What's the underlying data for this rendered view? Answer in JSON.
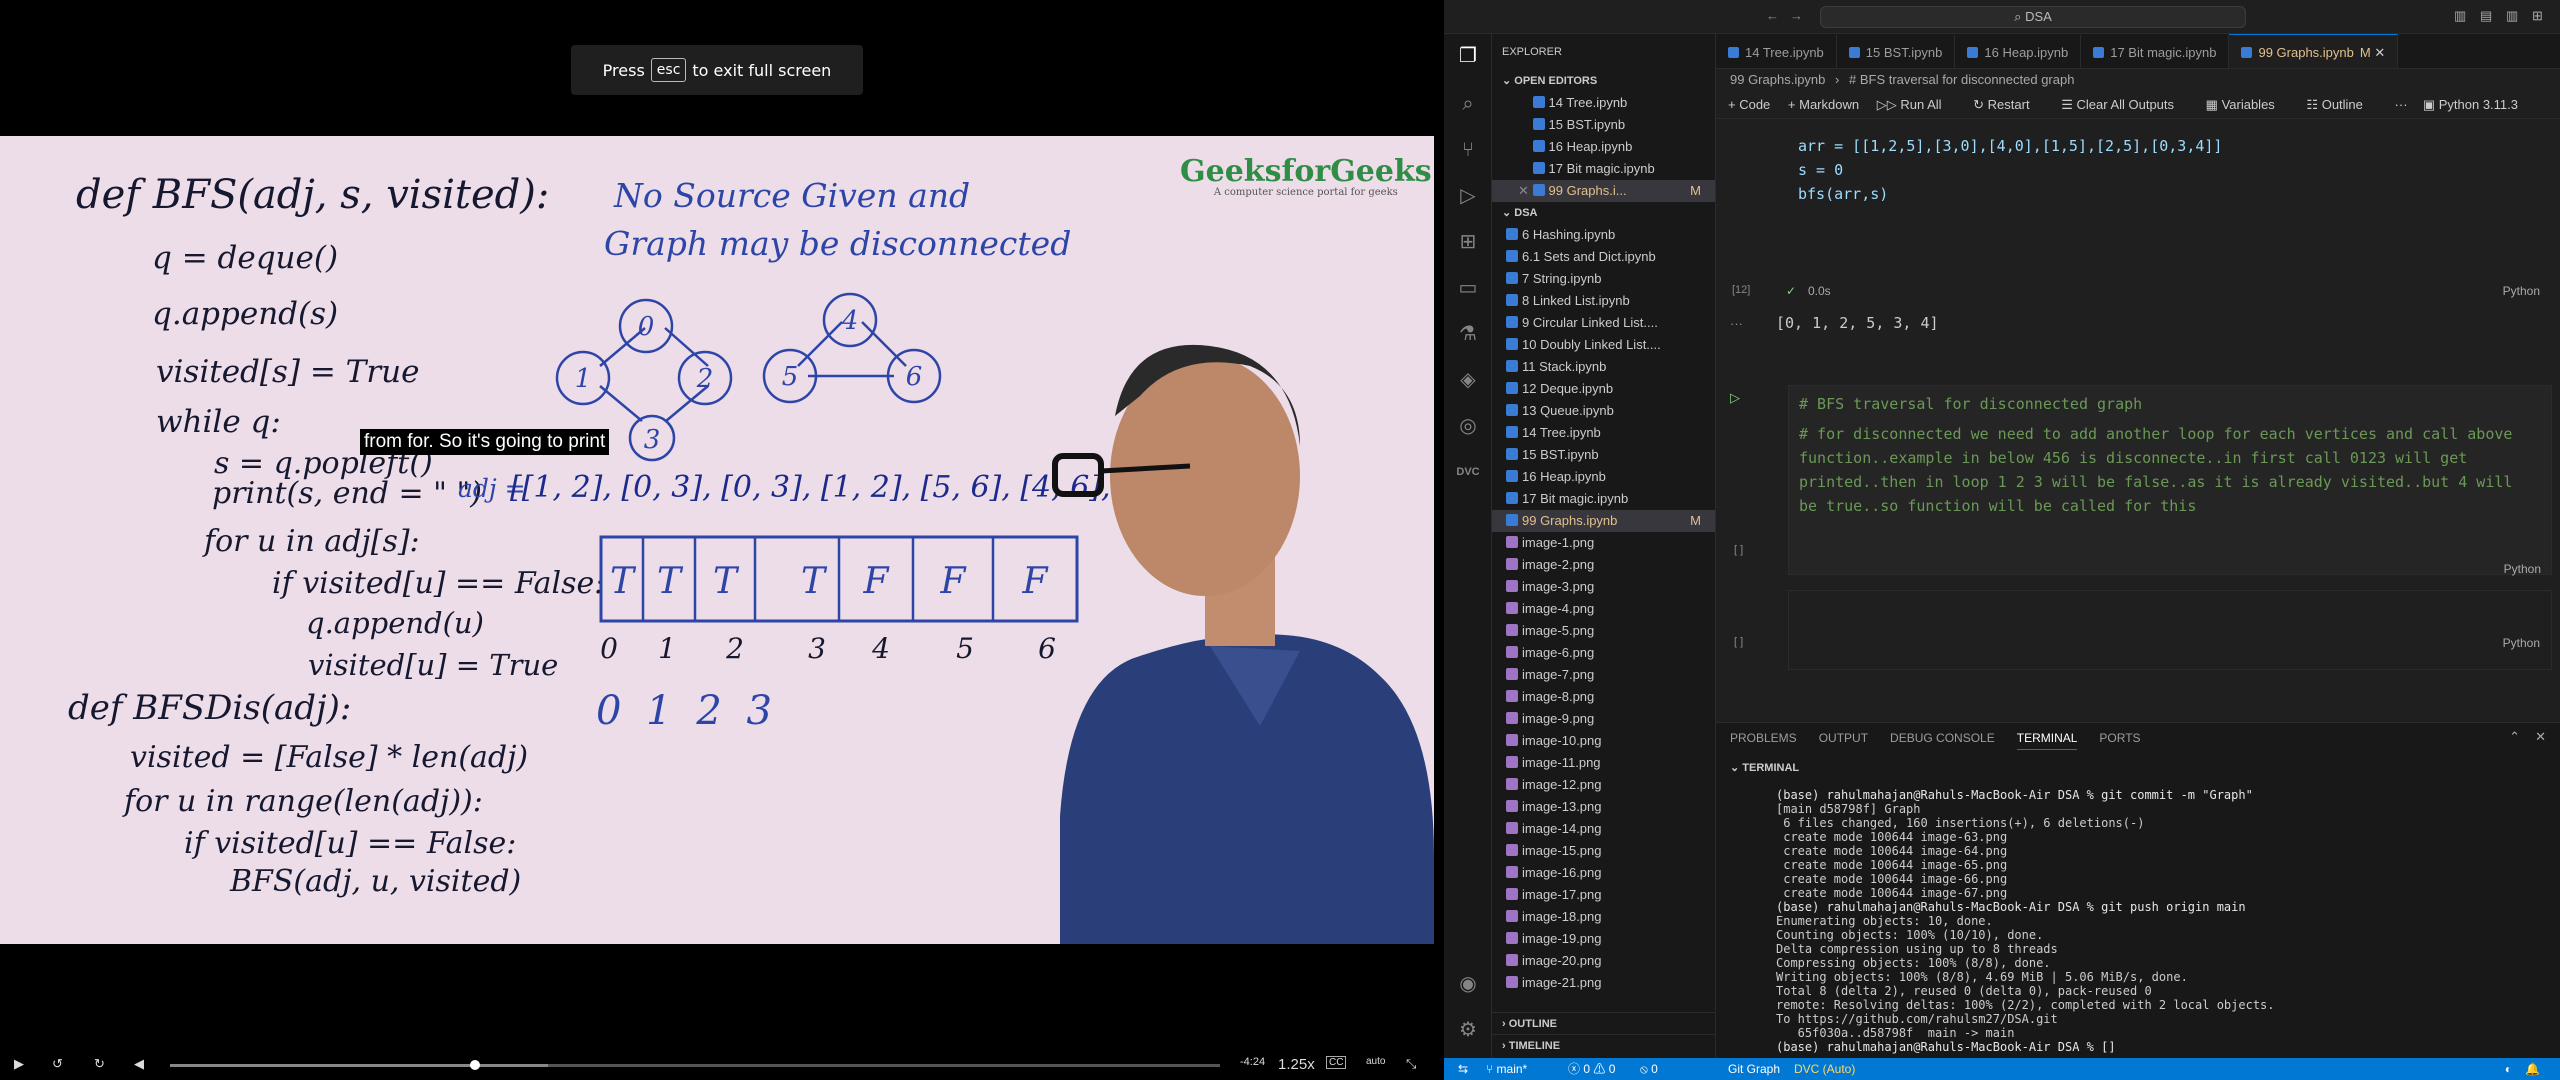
{
  "video": {
    "esc_prefix": "Press",
    "esc_key": "esc",
    "esc_suffix": "to exit full screen",
    "caption": "from for. So it's going to print",
    "logo_main": "GeeksforGeeks",
    "logo_sub": "A computer science portal for geeks",
    "board": {
      "def_bfs": "def BFS(adj, s, visited):",
      "q_deque": "q = deque()",
      "q_append": "q.append(s)",
      "visited_s": "visited[s] = True",
      "while_q": "while q:",
      "s_pop": "s = q.popleft()",
      "print_s": "print(s, end = \" \")",
      "adj_label": "adj =",
      "adj_list": "[[1, 2], [0, 3], [0, 3], [1, 2], [5, 6], [4, 6], [4, 5]]",
      "for_u": "for u in adj[s]:",
      "if_visited": "if visited[u] == False:",
      "q_append_u": "q.append(u)",
      "visited_u": "visited[u] = True",
      "def_bfsdis": "def BFSDis(adj):",
      "visited_init": "visited = [False] * len(adj)",
      "for_range": "for u in range(len(adj)):",
      "if_visited2": "if visited[u] == False:",
      "bfs_call": "BFS(adj, u, visited)",
      "note_line1": "No Source Given and",
      "note_line2": "Graph may be disconnected",
      "nodes": [
        "0",
        "1",
        "2",
        "3",
        "4",
        "5",
        "6"
      ],
      "array_cells": [
        "T",
        "T",
        "T",
        "T",
        "F",
        "F",
        "F"
      ],
      "array_index": [
        "0",
        "1",
        "2",
        "3",
        "4",
        "5",
        "6"
      ],
      "output": "0 1 2 3"
    },
    "controls": {
      "time_remaining": "-4:24",
      "speed": "1.25x",
      "cc": "CC",
      "quality": "auto",
      "progress_fraction": 0.29,
      "buffered_fraction": 0.36
    }
  },
  "vscode": {
    "search": "DSA",
    "explorer_title": "EXPLORER",
    "open_editors_title": "OPEN EDITORS",
    "open_editors": [
      {
        "name": "14 Tree.ipynb"
      },
      {
        "name": "15 BST.ipynb"
      },
      {
        "name": "16 Heap.ipynb"
      },
      {
        "name": "17 Bit magic.ipynb"
      },
      {
        "name": "99 Graphs.i...",
        "flag": "M"
      }
    ],
    "folder_title": "DSA",
    "files": [
      {
        "name": "6 Hashing.ipynb"
      },
      {
        "name": "6.1 Sets and Dict.ipynb"
      },
      {
        "name": "7 String.ipynb"
      },
      {
        "name": "8 Linked List.ipynb"
      },
      {
        "name": "9 Circular Linked List...."
      },
      {
        "name": "10 Doubly Linked List...."
      },
      {
        "name": "11 Stack.ipynb"
      },
      {
        "name": "12 Deque.ipynb"
      },
      {
        "name": "13 Queue.ipynb"
      },
      {
        "name": "14 Tree.ipynb"
      },
      {
        "name": "15 BST.ipynb"
      },
      {
        "name": "16 Heap.ipynb"
      },
      {
        "name": "17 Bit magic.ipynb"
      },
      {
        "name": "99 Graphs.ipynb",
        "flag": "M"
      },
      {
        "name": "image-1.png"
      },
      {
        "name": "image-2.png"
      },
      {
        "name": "image-3.png"
      },
      {
        "name": "image-4.png"
      },
      {
        "name": "image-5.png"
      },
      {
        "name": "image-6.png"
      },
      {
        "name": "image-7.png"
      },
      {
        "name": "image-8.png"
      },
      {
        "name": "image-9.png"
      },
      {
        "name": "image-10.png"
      },
      {
        "name": "image-11.png"
      },
      {
        "name": "image-12.png"
      },
      {
        "name": "image-13.png"
      },
      {
        "name": "image-14.png"
      },
      {
        "name": "image-15.png"
      },
      {
        "name": "image-16.png"
      },
      {
        "name": "image-17.png"
      },
      {
        "name": "image-18.png"
      },
      {
        "name": "image-19.png"
      },
      {
        "name": "image-20.png"
      },
      {
        "name": "image-21.png"
      }
    ],
    "outline_title": "OUTLINE",
    "timeline_title": "TIMELINE",
    "tabs": [
      {
        "name": "14 Tree.ipynb"
      },
      {
        "name": "15 BST.ipynb"
      },
      {
        "name": "16 Heap.ipynb"
      },
      {
        "name": "17 Bit magic.ipynb"
      },
      {
        "name": "99 Graphs.ipynb",
        "flag": "M",
        "active": true
      }
    ],
    "breadcrumb_file": "99 Graphs.ipynb",
    "breadcrumb_section": "# BFS traversal for disconnected graph",
    "toolbar": {
      "code": "+ Code",
      "markdown": "+ Markdown",
      "run_all": "Run All",
      "restart": "Restart",
      "clear": "Clear All Outputs",
      "variables": "Variables",
      "outline": "Outline",
      "kernel": "Python 3.11.3"
    },
    "cell12": {
      "line1": "arr = [[1,2,5],[3,0],[4,0],[1,5],[2,5],[0,3,4]]",
      "line2": "s = 0",
      "line3": "bfs(arr,s)",
      "exec_count": "[12]",
      "timing": "0.0s",
      "lang": "Python",
      "output": "[0, 1, 2, 5, 3, 4]"
    },
    "md_cell": {
      "heading": "# BFS traversal for disconnected graph",
      "body": [
        "# for disconnected we need to add another loop for each vertices and call above",
        "function..example in below 456 is disconnecte..in first call 0123 will get",
        "printed..then in loop 1 2 3 will be false..as it is already visited..but 4 will",
        "be true..so function will be called for this"
      ],
      "lang": "Python",
      "exec": "[ ]"
    },
    "empty_cell": {
      "exec": "[ ]",
      "lang": "Python"
    },
    "panel_tabs": [
      "PROBLEMS",
      "OUTPUT",
      "DEBUG CONSOLE",
      "TERMINAL",
      "PORTS"
    ],
    "terminal_title": "TERMINAL",
    "terminal_lines": [
      "(base) rahulmahajan@Rahuls-MacBook-Air DSA % git commit -m \"Graph\"",
      "[main d58798f] Graph",
      " 6 files changed, 160 insertions(+), 6 deletions(-)",
      " create mode 100644 image-63.png",
      " create mode 100644 image-64.png",
      " create mode 100644 image-65.png",
      " create mode 100644 image-66.png",
      " create mode 100644 image-67.png",
      "(base) rahulmahajan@Rahuls-MacBook-Air DSA % git push origin main",
      "Enumerating objects: 10, done.",
      "Counting objects: 100% (10/10), done.",
      "Delta compression using up to 8 threads",
      "Compressing objects: 100% (8/8), done.",
      "Writing objects: 100% (8/8), 4.69 MiB | 5.06 MiB/s, done.",
      "Total 8 (delta 2), reused 0 (delta 0), pack-reused 0",
      "remote: Resolving deltas: 100% (2/2), completed with 2 local objects.",
      "To https://github.com/rahulsm27/DSA.git",
      "   65f030a..d58798f  main -> main",
      "(base) rahulmahajan@Rahuls-MacBook-Air DSA % []"
    ],
    "status": {
      "branch": "main*",
      "errors": "0",
      "warnings": "0",
      "ports": "0",
      "git_graph": "Git Graph",
      "dvc": "DVC (Auto)"
    },
    "colors": {
      "accent": "#0078d4",
      "status_bar": "#0078d4",
      "comment": "#6a9955"
    }
  }
}
